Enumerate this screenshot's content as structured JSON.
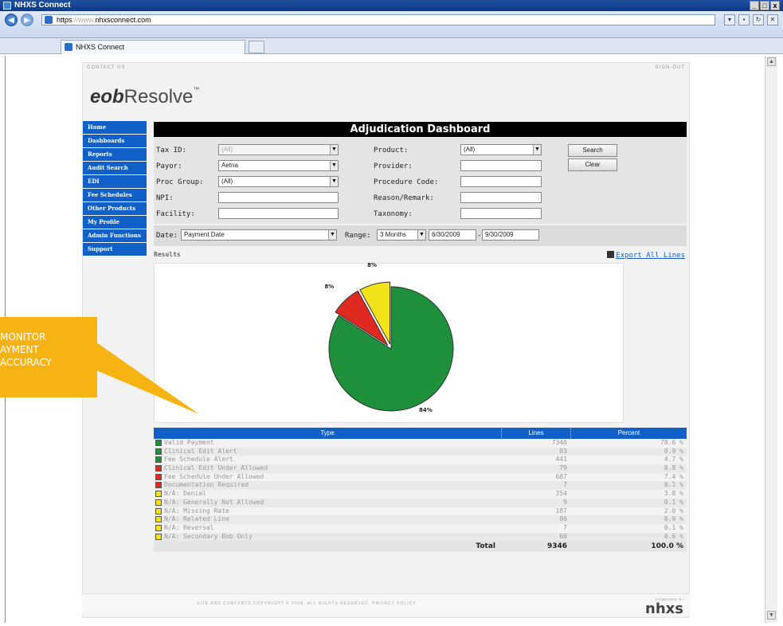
{
  "window": {
    "title": "NHXS Connect",
    "min": "_",
    "max": "□",
    "close": "x"
  },
  "address": {
    "proto": "https",
    "www": "://www.",
    "domain": "nhxsconnect.com"
  },
  "tab": {
    "label": "NHXS Connect"
  },
  "util": {
    "contact": "CONTACT US",
    "signout": "SIGN-OUT"
  },
  "logo": {
    "eob": "eob",
    "resolve": "Resolve",
    "tm": "™"
  },
  "nav": [
    "Home",
    "Dashboards",
    "Reports",
    "Audit Search",
    "EDI",
    "Fee Schedules",
    "Other Products",
    "My Profile",
    "Admin Functions",
    "Support"
  ],
  "dashboard": {
    "title": "Adjudication Dashboard"
  },
  "filters": {
    "tax_id_label": "Tax ID:",
    "tax_id_value": "(All)",
    "payor_label": "Payor:",
    "payor_value": "Aetna",
    "proc_group_label": "Proc Group:",
    "proc_group_value": "(All)",
    "npi_label": "NPI:",
    "facility_label": "Facility:",
    "product_label": "Product:",
    "product_value": "(All)",
    "provider_label": "Provider:",
    "procedure_code_label": "Procedure Code:",
    "reason_label": "Reason/Remark:",
    "taxonomy_label": "Taxonomy:",
    "search": "Search",
    "clear": "Clear"
  },
  "daterow": {
    "date_label": "Date:",
    "date_value": "Payment Date",
    "range_label": "Range:",
    "range_value": "3 Months",
    "from": "6/30/2009",
    "dash": "-",
    "to": "9/30/2009"
  },
  "results": {
    "label": "Results",
    "export": "Export All Lines"
  },
  "chart_data": {
    "type": "pie",
    "slices": [
      {
        "label": "84%",
        "value": 84,
        "color": "#1e8f3a"
      },
      {
        "label": "8%",
        "value": 8,
        "color": "#e02a20"
      },
      {
        "label": "8%",
        "value": 8,
        "color": "#f2e21a"
      }
    ]
  },
  "table": {
    "headers": [
      "Type",
      "Lines",
      "Percent"
    ],
    "rows": [
      {
        "color": "#1e8f3a",
        "type": "Valid Payment",
        "lines": "7346",
        "pct": "78.6 %"
      },
      {
        "color": "#1e8f3a",
        "type": "Clinical Edit Alert",
        "lines": "83",
        "pct": "0.9 %"
      },
      {
        "color": "#1e8f3a",
        "type": "Fee Schedule Alert",
        "lines": "441",
        "pct": "4.7 %"
      },
      {
        "color": "#e02a20",
        "type": "Clinical Edit Under Allowed",
        "lines": "79",
        "pct": "0.8 %"
      },
      {
        "color": "#e02a20",
        "type": "Fee Schedule Under Allowed",
        "lines": "687",
        "pct": "7.4 %"
      },
      {
        "color": "#e02a20",
        "type": "Documentation Required",
        "lines": "7",
        "pct": "0.1 %"
      },
      {
        "color": "#f2e21a",
        "type": "N/A: Denial",
        "lines": "354",
        "pct": "3.8 %"
      },
      {
        "color": "#f2e21a",
        "type": "N/A: Generally Not Allowed",
        "lines": "9",
        "pct": "0.1 %"
      },
      {
        "color": "#f2e21a",
        "type": "N/A: Missing Rate",
        "lines": "187",
        "pct": "2.0 %"
      },
      {
        "color": "#f2e21a",
        "type": "N/A: Related Line",
        "lines": "86",
        "pct": "0.9 %"
      },
      {
        "color": "#f2e21a",
        "type": "N/A: Reversal",
        "lines": "7",
        "pct": "0.1 %"
      },
      {
        "color": "#f2e21a",
        "type": "N/A: Secondary Bob Only",
        "lines": "60",
        "pct": "0.6 %"
      }
    ],
    "total_label": "Total",
    "total_lines": "9346",
    "total_pct": "100.0 %"
  },
  "footer": {
    "copyright": "SITE AND CONTENTS COPYRIGHT © 2009. ALL RIGHTS RESERVED. PRIVACY POLICY",
    "powered": "POWERED BY",
    "brand": "nhxs"
  },
  "callout": {
    "line1": "MONITOR",
    "line2": "AYMENT",
    "line3": "ACCURACY"
  }
}
